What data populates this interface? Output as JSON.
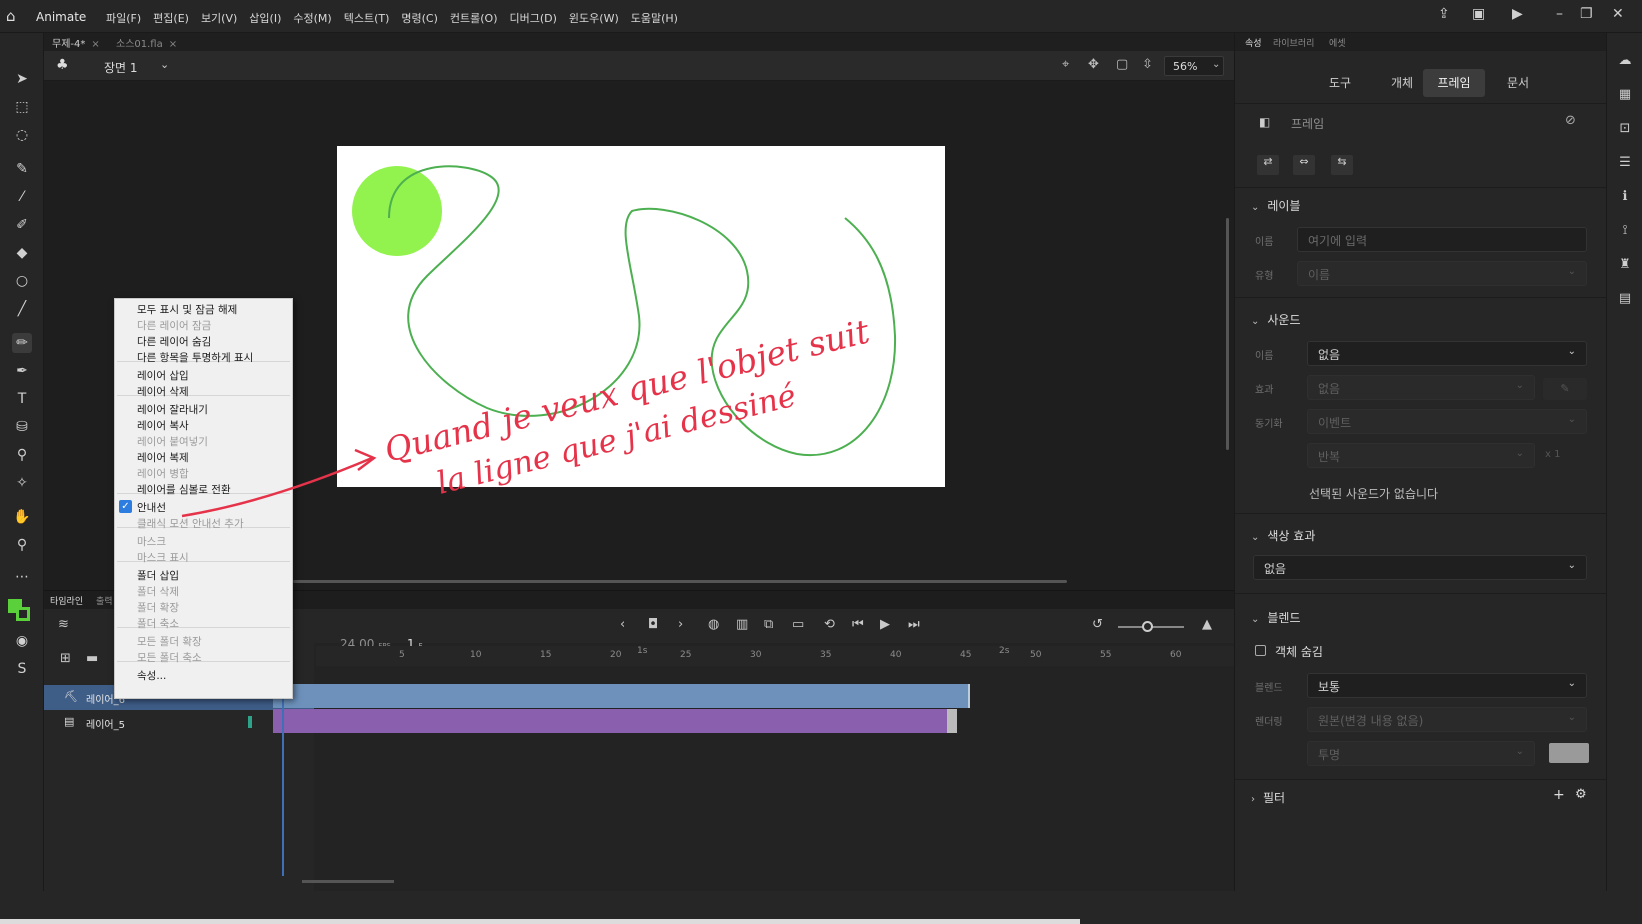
{
  "app": {
    "name": "Animate",
    "menus": [
      "파일(F)",
      "편집(E)",
      "보기(V)",
      "삽입(I)",
      "수정(M)",
      "텍스트(T)",
      "명령(C)",
      "컨트롤(O)",
      "디버그(D)",
      "윈도우(W)",
      "도움말(H)"
    ]
  },
  "doc_tabs": [
    {
      "label": "무제-4*",
      "close": "×"
    },
    {
      "label": "소스01.fla",
      "close": "×"
    }
  ],
  "scene": {
    "name": "장면 1",
    "zoom": "56%"
  },
  "stage": {
    "annotation_line1": "Quand je veux que l'objet suit",
    "annotation_line2": "la ligne que j'ai dessiné"
  },
  "timeline": {
    "tabs": [
      "타임라인",
      "출력"
    ],
    "fps": "24.00",
    "fps_unit": "FPS",
    "current_frame": "1",
    "current_frame_unit": "F",
    "ruler": [
      "1s",
      "5",
      "10",
      "15",
      "20",
      "25",
      "30",
      "35",
      "40",
      "45",
      "2s",
      "50",
      "55",
      "60"
    ],
    "layers": [
      {
        "name": "레이어_6",
        "selected": true
      },
      {
        "name": "레이어_5",
        "selected": false
      }
    ]
  },
  "context_menu": {
    "items": [
      {
        "label": "모두 표시 및 잠금 해제",
        "enabled": true
      },
      {
        "label": "다른 레이어 잠금",
        "enabled": false
      },
      {
        "label": "다른 레이어 숨김",
        "enabled": true
      },
      {
        "label": "다른 항목을 투명하게 표시",
        "enabled": true
      },
      {
        "label": "레이어 삽입",
        "enabled": true
      },
      {
        "label": "레이어 삭제",
        "enabled": true
      },
      {
        "label": "레이어 잘라내기",
        "enabled": true
      },
      {
        "label": "레이어 복사",
        "enabled": true
      },
      {
        "label": "레이어 붙여넣기",
        "enabled": false
      },
      {
        "label": "레이어 복제",
        "enabled": true
      },
      {
        "label": "레이어 병합",
        "enabled": false
      },
      {
        "label": "레이어를 심볼로 전환",
        "enabled": true
      },
      {
        "label": "안내선",
        "enabled": true,
        "checked": true
      },
      {
        "label": "클래식 모션 안내선 추가",
        "enabled": false
      },
      {
        "label": "마스크",
        "enabled": false
      },
      {
        "label": "마스크 표시",
        "enabled": false
      },
      {
        "label": "폴더 삽입",
        "enabled": true
      },
      {
        "label": "폴더 삭제",
        "enabled": false
      },
      {
        "label": "폴더 확장",
        "enabled": false
      },
      {
        "label": "폴더 축소",
        "enabled": false
      },
      {
        "label": "모든 폴더 확장",
        "enabled": false
      },
      {
        "label": "모든 폴더 축소",
        "enabled": false
      },
      {
        "label": "속성...",
        "enabled": true
      }
    ]
  },
  "properties": {
    "panel_tabs": [
      "속성",
      "라이브러리",
      "에셋"
    ],
    "seg_tabs": [
      "도구",
      "개체",
      "프레임",
      "문서"
    ],
    "active_seg": "프레임",
    "header": "프레임",
    "label_section": {
      "title": "레이블",
      "name_label": "이름",
      "name_placeholder": "여기에 입력",
      "type_label": "유형",
      "type_value": "이름"
    },
    "sound_section": {
      "title": "사운드",
      "name_label": "이름",
      "name_value": "없음",
      "effect_label": "효과",
      "effect_value": "없음",
      "sync_label": "동기화",
      "sync_value": "이벤트",
      "repeat_value": "반복",
      "repeat_count": "x 1",
      "no_sound_msg": "선택된 사운드가 없습니다"
    },
    "color_section": {
      "title": "색상 효과",
      "value": "없음"
    },
    "blend_section": {
      "title": "블렌드",
      "hide_object": "객체 숨김",
      "blend_label": "블렌드",
      "blend_value": "보통",
      "render_label": "렌더링",
      "render_value": "원본(변경 내용 없음)",
      "transparent_value": "투명"
    },
    "filter_section": {
      "title": "필터"
    }
  },
  "colors": {
    "circle_fill": "#92f24e",
    "guide_stroke": "#4caf50",
    "annotation": "#e5334a",
    "selected_layer": "#6d91bb",
    "guide_layer": "#8a5fae"
  }
}
